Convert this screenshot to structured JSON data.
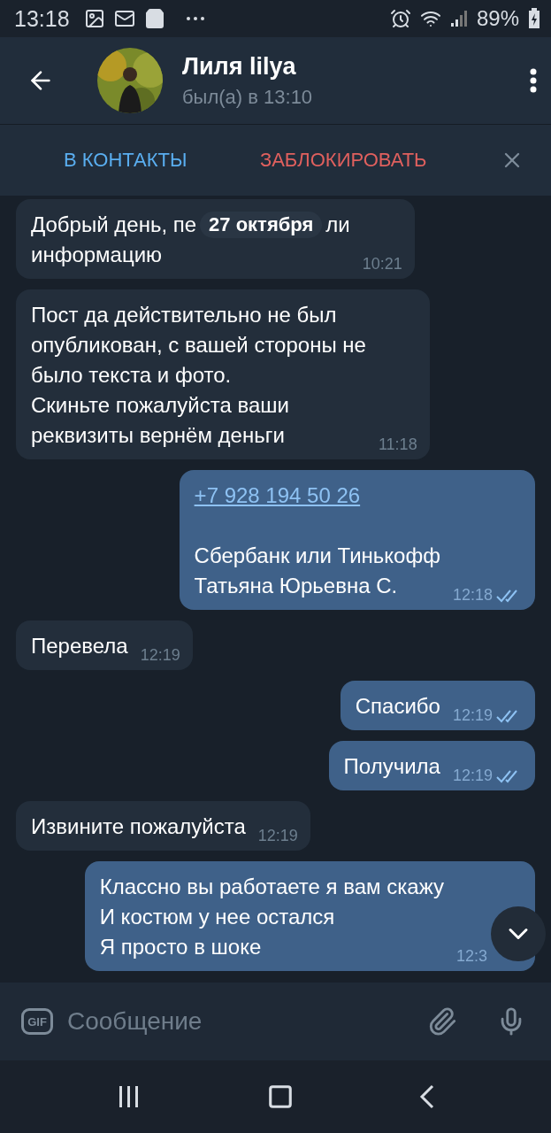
{
  "status_bar": {
    "time": "13:18",
    "battery": "89%"
  },
  "header": {
    "name": "Лиля lilya",
    "last_seen": "был(а) в 13:10"
  },
  "action_bar": {
    "add_contact": "В КОНТАКТЫ",
    "block": "ЗАБЛОКИРОВАТЬ"
  },
  "messages": [
    {
      "kind": "incoming",
      "date_pill": "27 октября",
      "lines": [
        "Добрый день, пе",
        "ли",
        "информацию"
      ],
      "time": "10:21",
      "read": false
    },
    {
      "kind": "incoming",
      "lines": [
        "Пост да действительно не был",
        "опубликован, с вашей стороны не",
        "было текста и фото.",
        "Скиньте пожалуйста ваши",
        "реквизиты вернём деньги"
      ],
      "time": "11:18",
      "read": false
    },
    {
      "kind": "outgoing",
      "link": "+7 928 194 50 26",
      "lines": [
        "Сбербанк или Тинькофф",
        "Татьяна Юрьевна С."
      ],
      "time": "12:18",
      "read": true
    },
    {
      "kind": "incoming",
      "lines": [
        "Перевела"
      ],
      "time": "12:19",
      "read": false
    },
    {
      "kind": "outgoing",
      "lines": [
        "Спасибо"
      ],
      "time": "12:19",
      "read": true
    },
    {
      "kind": "outgoing",
      "lines": [
        "Получила"
      ],
      "time": "12:19",
      "read": true
    },
    {
      "kind": "incoming",
      "lines": [
        "Извините пожалуйста"
      ],
      "time": "12:19",
      "read": false
    },
    {
      "kind": "outgoing",
      "lines": [
        "Классно вы работаете я вам скажу",
        "И костюм у нее остался",
        "Я просто в шоке"
      ],
      "time": "12:3",
      "read": false
    }
  ],
  "composer": {
    "gif": "GIF",
    "placeholder": "Сообщение"
  }
}
